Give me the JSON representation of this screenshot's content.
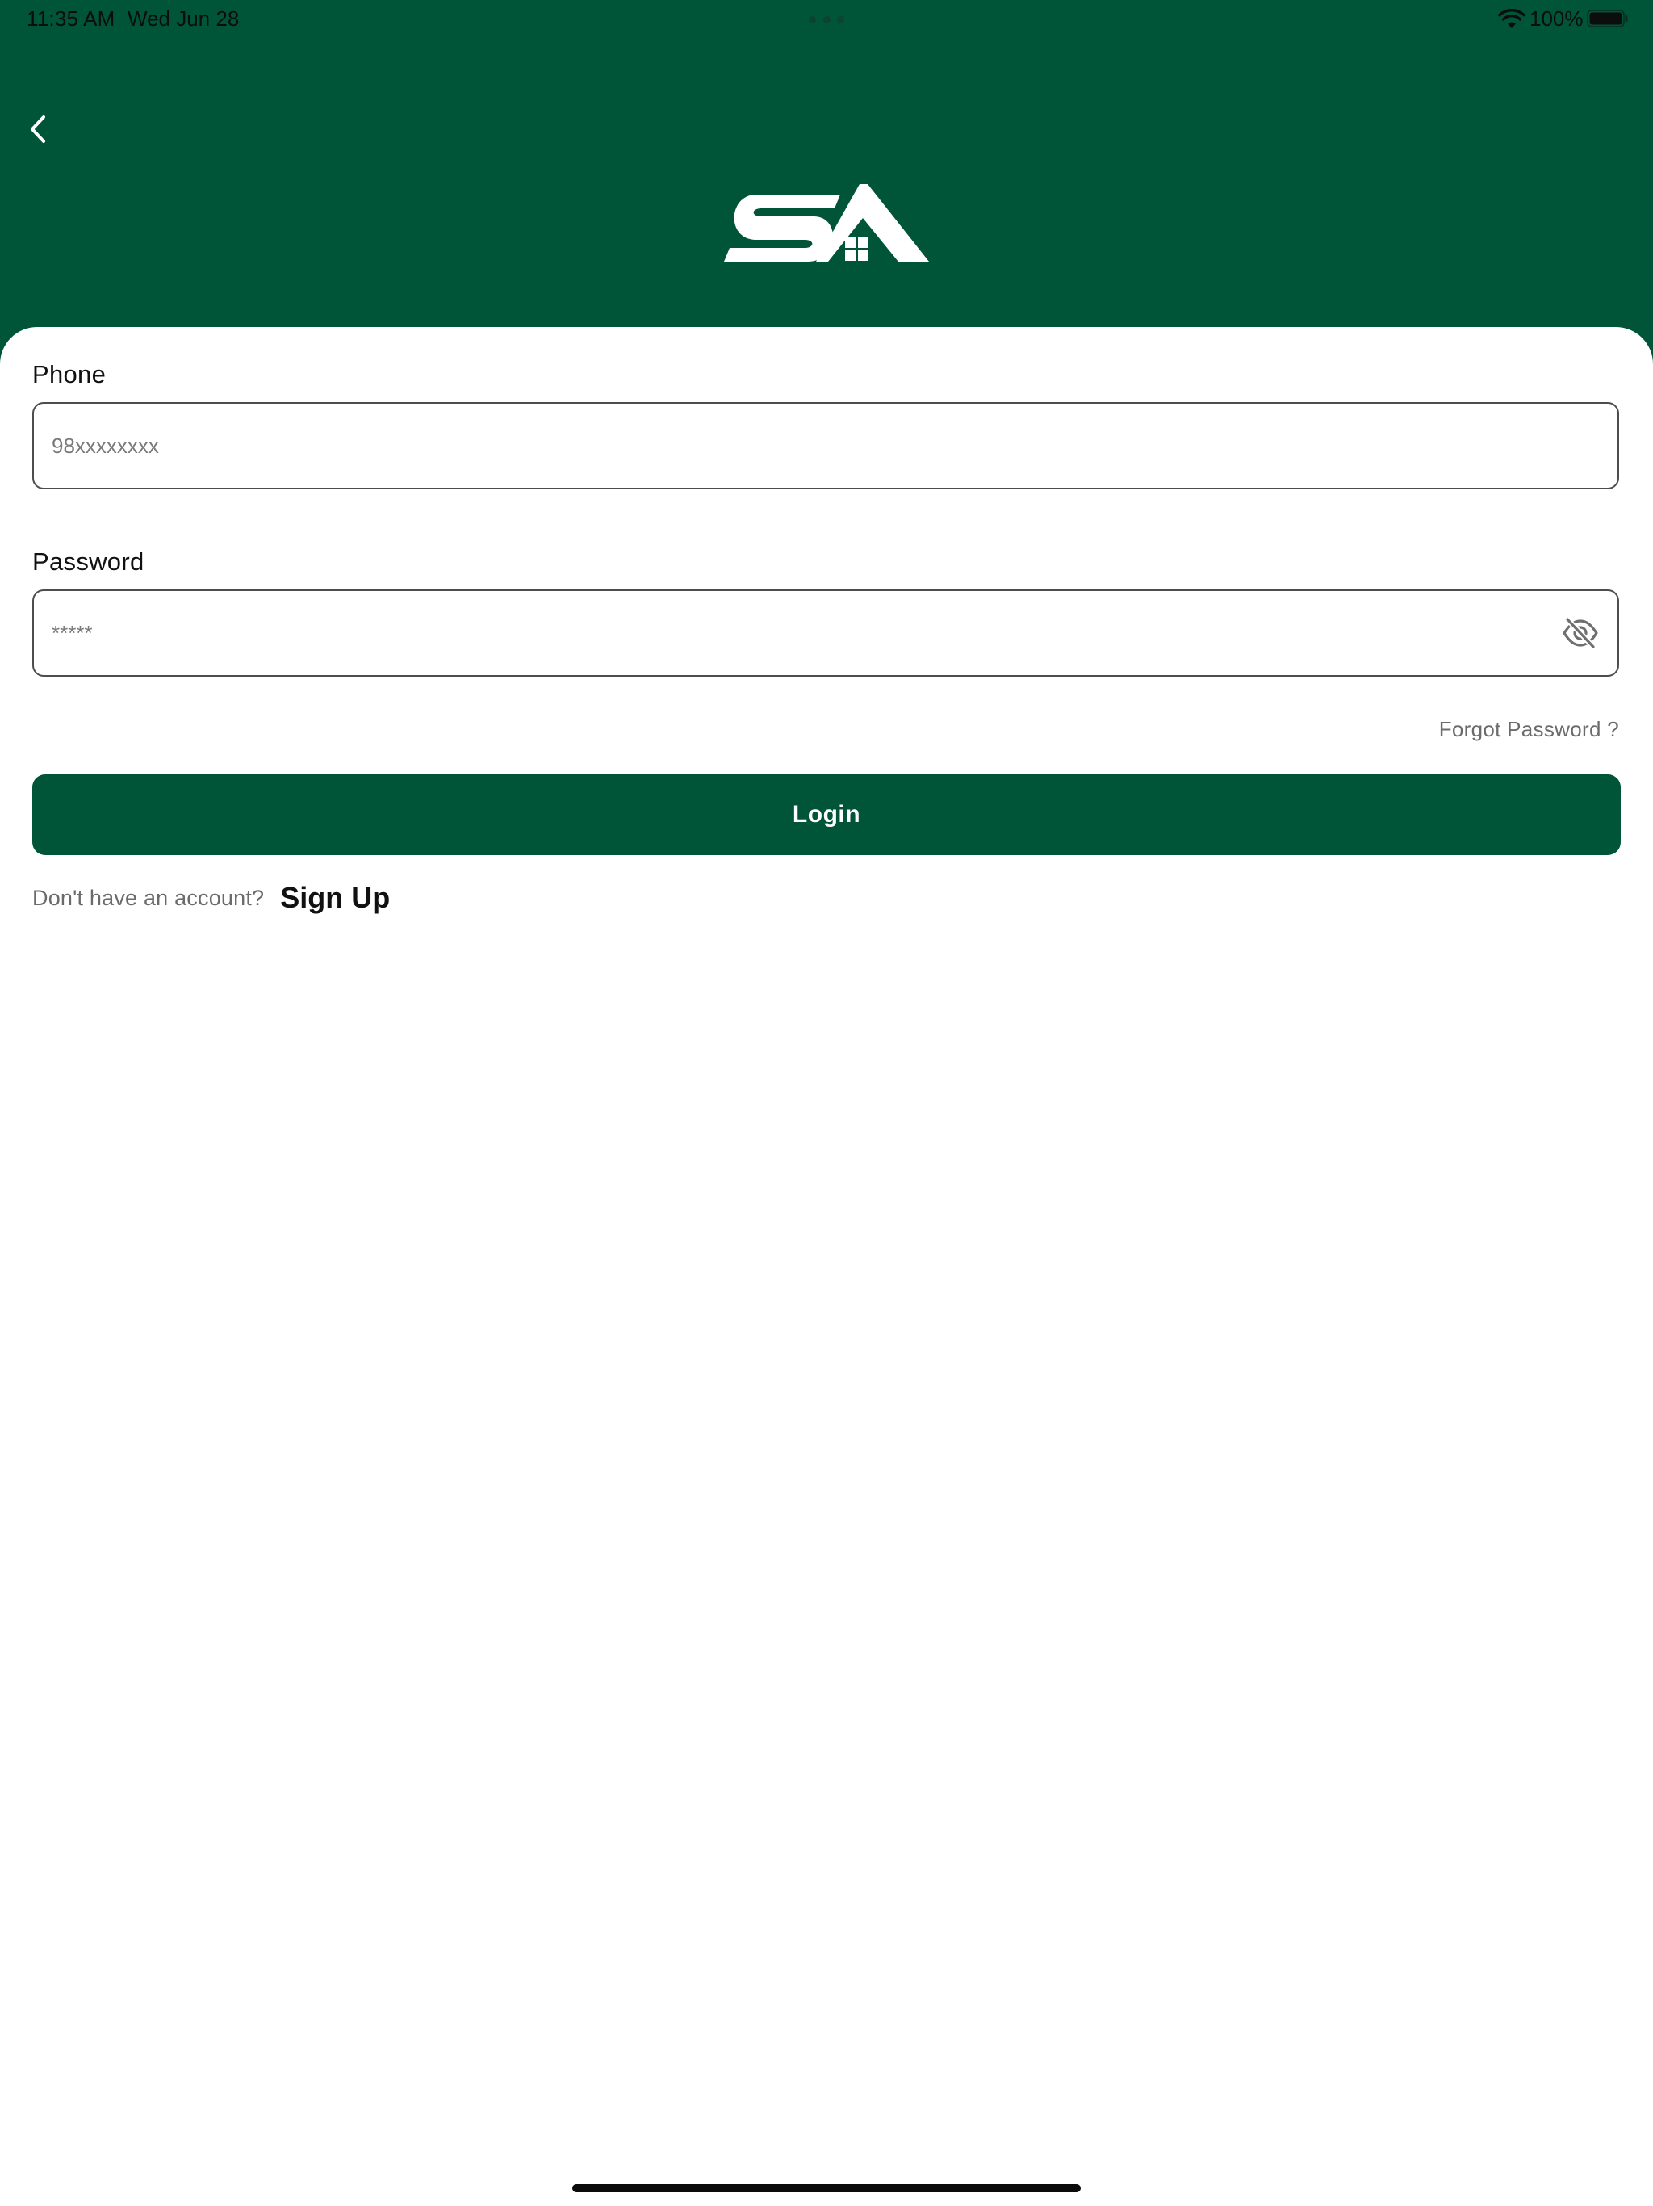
{
  "status_bar": {
    "time": "11:35 AM",
    "date": "Wed Jun 28",
    "battery_percent": "100%",
    "battery_level": 1.0,
    "wifi_icon": "wifi-icon",
    "battery_icon": "battery-icon"
  },
  "header": {
    "background_color": "#005539",
    "back_icon": "chevron-left-icon",
    "logo_icon": "sa-house-logo"
  },
  "form": {
    "phone": {
      "label": "Phone",
      "value": "",
      "placeholder": "98xxxxxxxx"
    },
    "password": {
      "label": "Password",
      "value": "",
      "placeholder": "*****",
      "toggle_icon": "eye-off-icon"
    },
    "forgot_password_label": "Forgot Password ?",
    "login_label": "Login",
    "signup_prompt": "Don't have an account?",
    "signup_label": "Sign Up"
  },
  "colors": {
    "brand_green": "#005539",
    "muted_text": "#6b6b6b",
    "input_border": "#4d4d4d"
  }
}
